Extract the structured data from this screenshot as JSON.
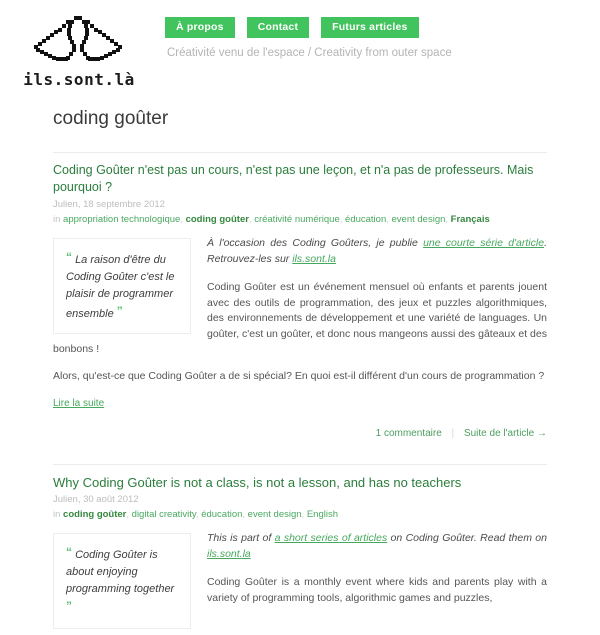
{
  "site": {
    "logo_word": "ils.sont.là",
    "logo_icon": "alien-pixel-logo",
    "tagline": "Créativité venu de l'espace / Creativity from outer space"
  },
  "nav": {
    "items": [
      {
        "label": "À propos"
      },
      {
        "label": "Contact"
      },
      {
        "label": "Futurs articles"
      }
    ]
  },
  "page": {
    "title": "coding goûter"
  },
  "colors": {
    "accent_green": "#41c35e",
    "link_green": "#46a85e",
    "title_green": "#2b7d3c",
    "muted_gray": "#bdbdbd"
  },
  "articles": [
    {
      "title": "Coding Goûter n'est pas un cours, n'est pas une leçon, et n'a pas de professeurs. Mais pourquoi ?",
      "byline": "Julien, 18 septembre 2012",
      "tags_prefix": "in",
      "tags": [
        {
          "label": "appropriation technologique",
          "bold": false
        },
        {
          "label": "coding goûter",
          "bold": true
        },
        {
          "label": "créativité numérique",
          "bold": false
        },
        {
          "label": "éducation",
          "bold": false
        },
        {
          "label": "event design",
          "bold": false
        },
        {
          "label": "Français",
          "bold": true
        }
      ],
      "pullquote": {
        "open": "“",
        "text": "La raison d'être du Coding Goûter c'est le plaisir de programmer ensemble",
        "close": "”"
      },
      "intro_before": "À l'occasion des Coding Goûters, je publie ",
      "intro_link1": "une courte série d'article",
      "intro_middle": ". Retrouvez-les sur ",
      "intro_link2": "ils.sont.la",
      "paragraphs": [
        "Coding Goûter est un événement mensuel où enfants et parents jouent avec des outils de programmation, des jeux et puzzles algorithmiques, des environnements de développement et une variété de languages. Un goûter, c'est un goûter, et donc nous mangeons aussi des gâteaux et des bonbons !",
        "Alors, qu'est-ce que Coding Goûter a de si spécial? En quoi est-il différent d'un cours de programmation ?"
      ],
      "read_more": "Lire la suite",
      "comments": "1 commentaire",
      "next": "Suite de l'article →"
    },
    {
      "title": "Why Coding Goûter is not a class, is not a lesson, and has no teachers",
      "byline": "Julien, 30 août 2012",
      "tags_prefix": "in",
      "tags": [
        {
          "label": "coding goûter",
          "bold": true
        },
        {
          "label": "digital creativity",
          "bold": false
        },
        {
          "label": "éducation",
          "bold": false
        },
        {
          "label": "event design",
          "bold": false
        },
        {
          "label": "English",
          "bold": false
        }
      ],
      "pullquote": {
        "open": "“",
        "text": "Coding Goûter is about enjoying programming together",
        "close": "”"
      },
      "intro_before": "This is part of ",
      "intro_link1": "a short series of articles",
      "intro_middle": " on Coding Goûter. Read them on ",
      "intro_link2": "ils.sont.la",
      "paragraphs": [
        "Coding Goûter is a monthly event where kids and parents play with a variety of programming tools, algorithmic games and puzzles,"
      ]
    }
  ]
}
